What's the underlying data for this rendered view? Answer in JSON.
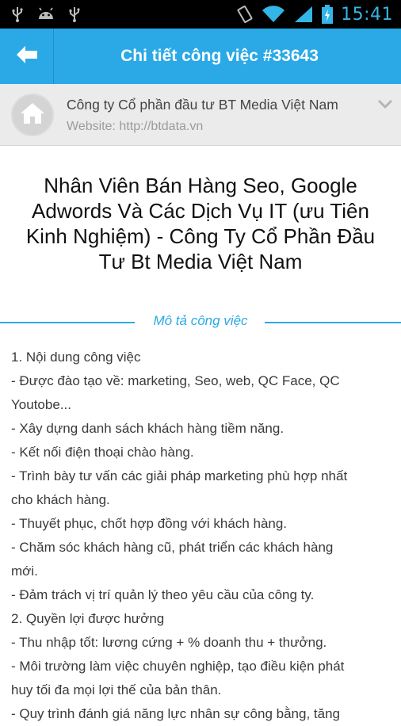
{
  "status_bar": {
    "clock": "15:41",
    "left_icons": [
      "usb-icon",
      "android-icon",
      "usb-icon"
    ],
    "right_icons": [
      "vibrate-icon",
      "wifi-icon",
      "signal-icon",
      "battery-charging-icon"
    ],
    "accent": "#33b5e5"
  },
  "action_bar": {
    "title": "Chi tiết công việc #33643",
    "back_icon": "arrow-left-icon",
    "color": "#2aa9e6"
  },
  "company": {
    "name": "Công ty Cổ phần đầu tư BT Media Việt Nam",
    "website": "Website: http://btdata.vn",
    "logo_icon": "home-icon",
    "expand_icon": "chevron-down-icon"
  },
  "job": {
    "title_lines": [
      "Nhân Viên Bán Hàng Seo, Google",
      "Adwords Và Các Dịch Vụ IT (ưu Tiên",
      "Kinh Nghiệm) - Công Ty Cổ Phần Đầu",
      "Tư Bt Media Việt Nam"
    ]
  },
  "section": {
    "label": "Mô tả công việc"
  },
  "description": [
    "1. Nội dung công việc",
    "- Được đào tạo về: marketing, Seo, web, QC Face, QC",
    "Youtobe...",
    "- Xây dựng danh sách khách hàng tiềm năng.",
    "- Kết nối điện thoại chào hàng.",
    "- Trình bày tư vấn các giải pháp marketing phù hợp nhất",
    "cho khách hàng.",
    "- Thuyết phục, chốt hợp đồng với khách hàng.",
    "- Chăm sóc khách hàng cũ, phát triển các khách hàng",
    "mới.",
    "- Đảm trách vị trí quản lý theo yêu cầu của công ty.",
    "2. Quyền lợi được hưởng",
    "- Thu nhập tốt: lương cứng + % doanh thu + thưởng.",
    "- Môi trường làm việc chuyên nghiệp, tạo điều kiện phát",
    "huy tối đa mọi lợi thế của bản thân.",
    "- Quy trình đánh giá năng lực nhân sự công bằng, tăng"
  ]
}
